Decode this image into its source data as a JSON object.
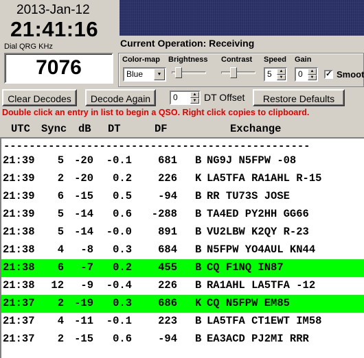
{
  "clock": {
    "date": "2013-Jan-12",
    "time": "21:41:16",
    "qrg_label": "Dial QRG KHz",
    "frequency": "7076"
  },
  "status": {
    "current_operation": "Current Operation:  Receiving"
  },
  "controls": {
    "colormap_label": "Color-map",
    "colormap_value": "Blue",
    "brightness_label": "Brightness",
    "contrast_label": "Contrast",
    "speed_label": "Speed",
    "speed_value": "5",
    "gain_label": "Gain",
    "gain_value": "0",
    "smooth_label": "Smoot",
    "smooth_checked": "✓"
  },
  "buttons": {
    "clear_decodes": "Clear Decodes",
    "decode_again": "Decode Again",
    "dt_offset_value": "0",
    "dt_offset_label": "DT Offset",
    "restore_defaults": "Restore Defaults"
  },
  "hint": "Double click an entry in list to begin a QSO.  Right click copies to clipboard.",
  "columns": {
    "utc": "UTC",
    "sync": "Sync",
    "db": "dB",
    "dt": "DT",
    "df": "DF",
    "exchange": "Exchange"
  },
  "separator": "------------------------------------------------",
  "decodes": [
    {
      "utc": "21:39",
      "sync": "5",
      "db": "-20",
      "dt": "-0.1",
      "df": "681",
      "mode": "B",
      "exchange": "NG9J N5FPW -08",
      "highlight": false
    },
    {
      "utc": "21:39",
      "sync": "2",
      "db": "-20",
      "dt": "0.2",
      "df": "226",
      "mode": "K",
      "exchange": "LA5TFA RA1AHL R-15",
      "highlight": false
    },
    {
      "utc": "21:39",
      "sync": "6",
      "db": "-15",
      "dt": "0.5",
      "df": "-94",
      "mode": "B",
      "exchange": "RR TU73S JOSE",
      "highlight": false
    },
    {
      "utc": "21:39",
      "sync": "5",
      "db": "-14",
      "dt": "0.6",
      "df": "-288",
      "mode": "B",
      "exchange": "TA4ED PY2HH GG66",
      "highlight": false
    },
    {
      "utc": "21:38",
      "sync": "5",
      "db": "-14",
      "dt": "-0.0",
      "df": "891",
      "mode": "B",
      "exchange": "VU2LBW K2QY R-23",
      "highlight": false
    },
    {
      "utc": "21:38",
      "sync": "4",
      "db": "-8",
      "dt": "0.3",
      "df": "684",
      "mode": "B",
      "exchange": "N5FPW YO4AUL KN44",
      "highlight": false
    },
    {
      "utc": "21:38",
      "sync": "6",
      "db": "-7",
      "dt": "0.2",
      "df": "455",
      "mode": "B",
      "exchange": "CQ F1NQ IN87",
      "highlight": true
    },
    {
      "utc": "21:38",
      "sync": "12",
      "db": "-9",
      "dt": "-0.4",
      "df": "226",
      "mode": "B",
      "exchange": "RA1AHL LA5TFA -12",
      "highlight": false
    },
    {
      "utc": "21:37",
      "sync": "2",
      "db": "-19",
      "dt": "0.3",
      "df": "686",
      "mode": "K",
      "exchange": "CQ N5FPW EM85",
      "highlight": true
    },
    {
      "utc": "21:37",
      "sync": "4",
      "db": "-11",
      "dt": "-0.1",
      "df": "223",
      "mode": "B",
      "exchange": "LA5TFA CT1EWT IM58",
      "highlight": false
    },
    {
      "utc": "21:37",
      "sync": "2",
      "db": "-15",
      "dt": "0.6",
      "df": "-94",
      "mode": "B",
      "exchange": "EA3ACD PJ2MI RRR",
      "highlight": false
    }
  ],
  "colors": {
    "highlight": "#00ff00",
    "hint_text": "#e00000",
    "waterfall": "#2a2f63"
  }
}
